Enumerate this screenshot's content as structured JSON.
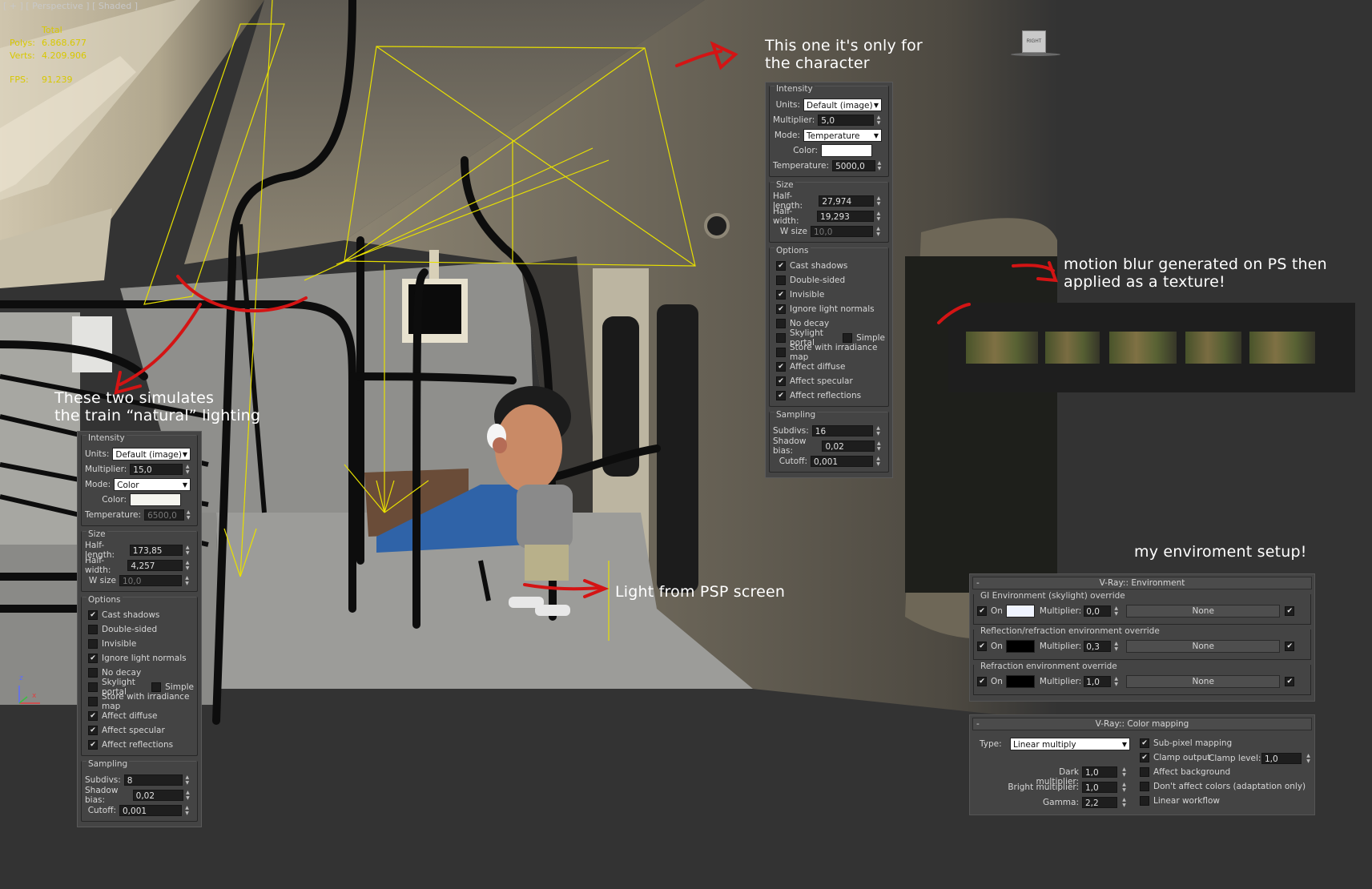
{
  "viewport": {
    "label": "[ + ] [ Perspective ] [ Shaded ]",
    "stats_header": "Total",
    "polys_label": "Polys:",
    "polys_value": "6.868.677",
    "verts_label": "Verts:",
    "verts_value": "4.209.906",
    "fps_label": "FPS:",
    "fps_value": "91,239",
    "viewcube_label": "RIGHT",
    "axis_z": "z",
    "axis_x": "x"
  },
  "annotations": {
    "character_line1": "This one it's only for",
    "character_line2": "the character",
    "train_line1": "These two simulates",
    "train_line2": "the train “natural” lighting",
    "motion_line1": "motion blur generated on PS then",
    "motion_line2": "applied as a texture!",
    "psp": "Light from PSP screen",
    "env_setup": "my enviroment setup!"
  },
  "labels": {
    "intensity": "Intensity",
    "units": "Units:",
    "multiplier": "Multiplier:",
    "mode": "Mode:",
    "color": "Color:",
    "temperature": "Temperature:",
    "size": "Size",
    "half_length": "Half-length:",
    "half_width": "Half-width:",
    "w_size": "W size",
    "options": "Options",
    "cast_shadows": "Cast shadows",
    "double_sided": "Double-sided",
    "invisible": "Invisible",
    "ignore_light_normals": "Ignore light normals",
    "no_decay": "No decay",
    "skylight_portal": "Skylight portal",
    "simple": "Simple",
    "store_irradiance": "Store with irradiance map",
    "affect_diffuse": "Affect diffuse",
    "affect_specular": "Affect specular",
    "affect_reflections": "Affect reflections",
    "sampling": "Sampling",
    "subdivs": "Subdivs:",
    "shadow_bias": "Shadow bias:",
    "cutoff": "Cutoff:"
  },
  "panel_char": {
    "units": "Default (image)",
    "multiplier": "5,0",
    "mode": "Temperature",
    "color_hex": "#ffffff",
    "temperature": "5000,0",
    "half_length": "27,974",
    "half_width": "19,293",
    "w_size": "10,0",
    "cast_shadows": true,
    "double_sided": false,
    "invisible": true,
    "ignore_light_normals": true,
    "no_decay": false,
    "skylight_portal": false,
    "simple": false,
    "store_irradiance": false,
    "affect_diffuse": true,
    "affect_specular": true,
    "affect_reflections": true,
    "subdivs": "16",
    "shadow_bias": "0,02",
    "cutoff": "0,001"
  },
  "panel_train": {
    "units": "Default (image)",
    "multiplier": "15,0",
    "mode": "Color",
    "color_hex": "#f5f5ef",
    "temperature": "6500,0",
    "half_length": "173,85",
    "half_width": "4,257",
    "w_size": "10,0",
    "cast_shadows": true,
    "double_sided": false,
    "invisible": false,
    "ignore_light_normals": true,
    "no_decay": false,
    "skylight_portal": false,
    "simple": false,
    "store_irradiance": false,
    "affect_diffuse": true,
    "affect_specular": true,
    "affect_reflections": true,
    "subdivs": "8",
    "shadow_bias": "0,02",
    "cutoff": "0,001"
  },
  "environment": {
    "title": "V-Ray:: Environment",
    "minus": "-",
    "on_label": "On",
    "multiplier_label": "Multiplier:",
    "none_label": "None",
    "gi": {
      "title": "GI Environment (skylight) override",
      "on": true,
      "color_hex": "#f0f4ff",
      "multiplier": "0,0",
      "map_on": true
    },
    "reflection": {
      "title": "Reflection/refraction environment override",
      "on": true,
      "color_hex": "#000000",
      "multiplier": "0,3",
      "map_on": true
    },
    "refraction": {
      "title": "Refraction environment override",
      "on": true,
      "color_hex": "#000000",
      "multiplier": "1,0",
      "map_on": true
    }
  },
  "color_mapping": {
    "title": "V-Ray:: Color mapping",
    "minus": "-",
    "type_label": "Type:",
    "type_value": "Linear multiply",
    "dark_label": "Dark multiplier:",
    "dark_value": "1,0",
    "bright_label": "Bright multiplier:",
    "bright_value": "1,0",
    "gamma_label": "Gamma:",
    "gamma_value": "2,2",
    "subpixel_label": "Sub-pixel mapping",
    "subpixel_on": true,
    "clamp_label": "Clamp output",
    "clamp_on": true,
    "clamp_level_label": "Clamp level:",
    "clamp_level_value": "1,0",
    "affect_bg_label": "Affect background",
    "affect_bg_on": false,
    "dont_affect_label": "Don't affect colors (adaptation only)",
    "dont_affect_on": false,
    "linear_label": "Linear workflow",
    "linear_on": false
  },
  "colors": {
    "accent_red": "#d41414",
    "light_yellow": "#e8e000",
    "stats_yellow": "#d8c800"
  }
}
